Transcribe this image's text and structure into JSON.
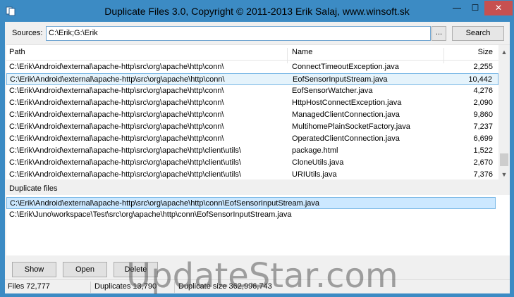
{
  "window": {
    "title": "Duplicate Files 3.0, Copyright © 2011-2013 Erik Salaj, www.winsoft.sk",
    "minimize_glyph": "—",
    "maximize_glyph": "☐",
    "close_glyph": "✕"
  },
  "sources": {
    "label": "Sources:",
    "value": "C:\\Erik;G:\\Erik",
    "browse_label": "...",
    "search_label": "Search"
  },
  "table": {
    "headers": {
      "path": "Path",
      "name": "Name",
      "size": "Size"
    },
    "rows": [
      {
        "path": "C:\\Erik\\Android\\external\\apache-http\\src\\org\\apache\\http\\conn\\",
        "name": "ConnectTimeoutException.java",
        "size": "2,255",
        "selected": false
      },
      {
        "path": "C:\\Erik\\Android\\external\\apache-http\\src\\org\\apache\\http\\conn\\",
        "name": "EofSensorInputStream.java",
        "size": "10,442",
        "selected": true
      },
      {
        "path": "C:\\Erik\\Android\\external\\apache-http\\src\\org\\apache\\http\\conn\\",
        "name": "EofSensorWatcher.java",
        "size": "4,276",
        "selected": false
      },
      {
        "path": "C:\\Erik\\Android\\external\\apache-http\\src\\org\\apache\\http\\conn\\",
        "name": "HttpHostConnectException.java",
        "size": "2,090",
        "selected": false
      },
      {
        "path": "C:\\Erik\\Android\\external\\apache-http\\src\\org\\apache\\http\\conn\\",
        "name": "ManagedClientConnection.java",
        "size": "9,860",
        "selected": false
      },
      {
        "path": "C:\\Erik\\Android\\external\\apache-http\\src\\org\\apache\\http\\conn\\",
        "name": "MultihomePlainSocketFactory.java",
        "size": "7,237",
        "selected": false
      },
      {
        "path": "C:\\Erik\\Android\\external\\apache-http\\src\\org\\apache\\http\\conn\\",
        "name": "OperatedClientConnection.java",
        "size": "6,699",
        "selected": false
      },
      {
        "path": "C:\\Erik\\Android\\external\\apache-http\\src\\org\\apache\\http\\client\\utils\\",
        "name": "package.html",
        "size": "1,522",
        "selected": false
      },
      {
        "path": "C:\\Erik\\Android\\external\\apache-http\\src\\org\\apache\\http\\client\\utils\\",
        "name": "CloneUtils.java",
        "size": "2,670",
        "selected": false
      },
      {
        "path": "C:\\Erik\\Android\\external\\apache-http\\src\\org\\apache\\http\\client\\utils\\",
        "name": "URIUtils.java",
        "size": "7,376",
        "selected": false
      }
    ]
  },
  "duplicates": {
    "label": "Duplicate files",
    "items": [
      {
        "path": "C:\\Erik\\Android\\external\\apache-http\\src\\org\\apache\\http\\conn\\EofSensorInputStream.java",
        "selected": true
      },
      {
        "path": "C:\\Erik\\Juno\\workspace\\Test\\src\\org\\apache\\http\\conn\\EofSensorInputStream.java",
        "selected": false
      }
    ]
  },
  "buttons": {
    "show": "Show",
    "open": "Open",
    "delete": "Delete"
  },
  "status": {
    "files": "Files 72,777",
    "duplicates": "Duplicates 13,790",
    "duplicate_size": "Duplicate size 362,996,743"
  },
  "watermark": "UpdateStar.com",
  "colors": {
    "title_bar": "#3c8bc4",
    "close_button": "#c75050",
    "selection": "#cce8ff",
    "selection_border": "#7ab8e6"
  }
}
